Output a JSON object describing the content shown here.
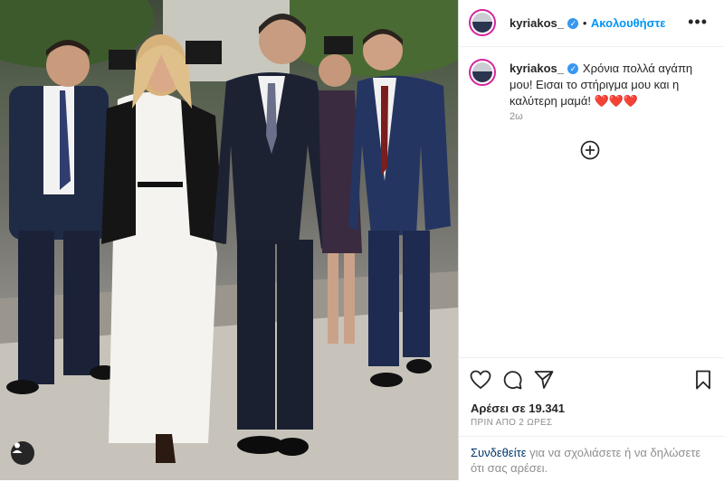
{
  "post": {
    "username": "kyriakos_",
    "follow_label": "Ακολουθήστε",
    "separator": "•",
    "caption": "Χρόνια πολλά αγάπη μου! Εισαι το στήριγμα μου και η καλύτερη μαμά! ❤️❤️❤️",
    "caption_age": "2ω",
    "likes_label": "Αρέσει σε 19.341",
    "posted_ago": "ΠΡΙΝ ΑΠΟ 2 ΩΡΕΣ",
    "more_label": "•••"
  },
  "login_prompt": {
    "link": "Συνδεθείτε",
    "text": " για να σχολιάσετε ή να δηλώσετε ότι σας αρέσει."
  },
  "icons": {
    "like": "heart-icon",
    "comment": "comment-icon",
    "share": "paper-plane-icon",
    "save": "bookmark-icon",
    "add": "plus-circle-icon",
    "verified": "verified-badge-icon",
    "tagged": "user-tag-icon",
    "options": "more-options-icon"
  },
  "colors": {
    "accent": "#0095f6",
    "verified": "#3897f0",
    "heart": "#ed4956",
    "text": "#262626",
    "muted": "#8e8e8e"
  }
}
